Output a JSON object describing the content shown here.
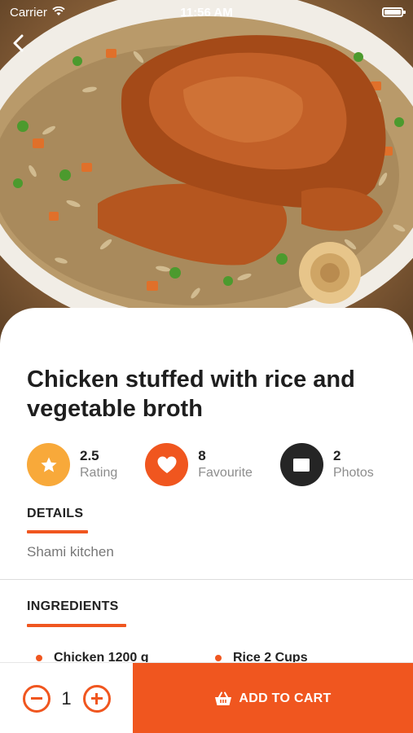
{
  "status_bar": {
    "carrier": "Carrier",
    "time": "11:56 AM"
  },
  "recipe": {
    "title": "Chicken stuffed with rice and vegetable broth"
  },
  "stats": [
    {
      "value": "2.5",
      "label": "Rating",
      "icon": "star-icon",
      "color": "#f8a93a"
    },
    {
      "value": "8",
      "label": "Favourite",
      "icon": "heart-icon",
      "color": "#f0561f"
    },
    {
      "value": "2",
      "label": "Photos",
      "icon": "photo-icon",
      "color": "#252525"
    }
  ],
  "details": {
    "title": "DETAILS",
    "text": "Shami kitchen"
  },
  "ingredients": {
    "title": "INGREDIENTS",
    "items": [
      "Chicken 1200 g",
      "Rice 2 Cups"
    ]
  },
  "cart": {
    "quantity": "1",
    "add_label": "ADD TO CART"
  },
  "colors": {
    "accent": "#f0561f",
    "rating": "#f8a93a",
    "photos": "#252525"
  }
}
